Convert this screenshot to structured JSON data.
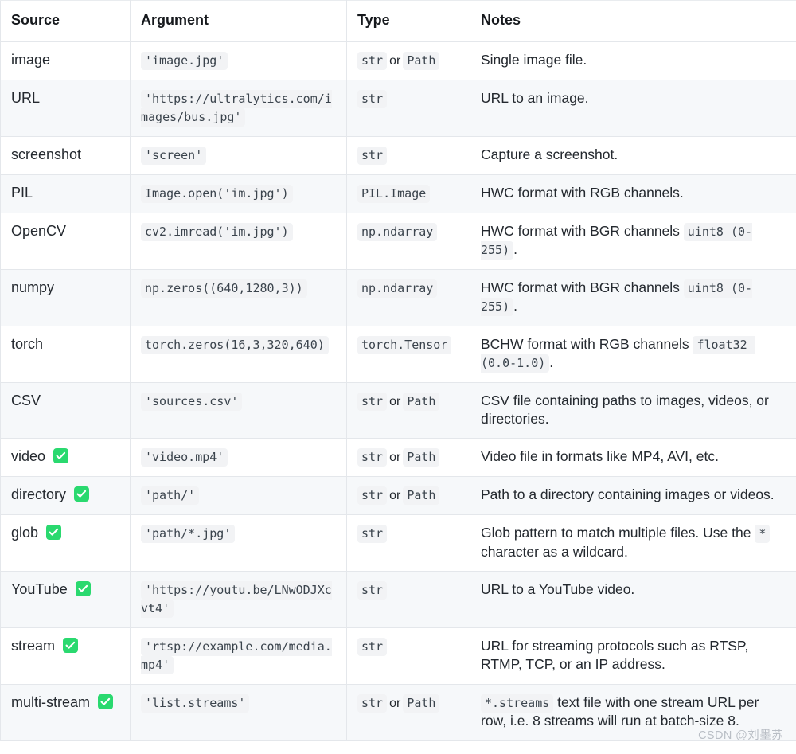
{
  "table": {
    "columns": [
      "Source",
      "Argument",
      "Type",
      "Notes"
    ],
    "rows": [
      {
        "source": "image",
        "verified": false,
        "argument": "'image.jpg'",
        "type_codes": [
          "str",
          "Path"
        ],
        "type_separator": "or",
        "notes_parts": [
          {
            "kind": "text",
            "text": "Single image file."
          }
        ]
      },
      {
        "source": "URL",
        "verified": false,
        "argument": "'https://ultralytics.com/images/bus.jpg'",
        "type_codes": [
          "str"
        ],
        "type_separator": "",
        "notes_parts": [
          {
            "kind": "text",
            "text": "URL to an image."
          }
        ]
      },
      {
        "source": "screenshot",
        "verified": false,
        "argument": "'screen'",
        "type_codes": [
          "str"
        ],
        "type_separator": "",
        "notes_parts": [
          {
            "kind": "text",
            "text": "Capture a screenshot."
          }
        ]
      },
      {
        "source": "PIL",
        "verified": false,
        "argument": "Image.open('im.jpg')",
        "type_codes": [
          "PIL.Image"
        ],
        "type_separator": "",
        "notes_parts": [
          {
            "kind": "text",
            "text": "HWC format with RGB channels."
          }
        ]
      },
      {
        "source": "OpenCV",
        "verified": false,
        "argument": "cv2.imread('im.jpg')",
        "type_codes": [
          "np.ndarray"
        ],
        "type_separator": "",
        "notes_parts": [
          {
            "kind": "text",
            "text": "HWC format with BGR channels "
          },
          {
            "kind": "code",
            "text": "uint8 (0-255)"
          },
          {
            "kind": "text",
            "text": "."
          }
        ]
      },
      {
        "source": "numpy",
        "verified": false,
        "argument": "np.zeros((640,1280,3))",
        "type_codes": [
          "np.ndarray"
        ],
        "type_separator": "",
        "notes_parts": [
          {
            "kind": "text",
            "text": "HWC format with BGR channels "
          },
          {
            "kind": "code",
            "text": "uint8 (0-255)"
          },
          {
            "kind": "text",
            "text": "."
          }
        ]
      },
      {
        "source": "torch",
        "verified": false,
        "argument": "torch.zeros(16,3,320,640)",
        "type_codes": [
          "torch.Tensor"
        ],
        "type_separator": "",
        "notes_parts": [
          {
            "kind": "text",
            "text": "BCHW format with RGB channels "
          },
          {
            "kind": "code",
            "text": "float32 (0.0-1.0)"
          },
          {
            "kind": "text",
            "text": "."
          }
        ]
      },
      {
        "source": "CSV",
        "verified": false,
        "argument": "'sources.csv'",
        "type_codes": [
          "str",
          "Path"
        ],
        "type_separator": "or",
        "notes_parts": [
          {
            "kind": "text",
            "text": "CSV file containing paths to images, videos, or directories."
          }
        ]
      },
      {
        "source": "video",
        "verified": true,
        "argument": "'video.mp4'",
        "type_codes": [
          "str",
          "Path"
        ],
        "type_separator": "or",
        "notes_parts": [
          {
            "kind": "text",
            "text": "Video file in formats like MP4, AVI, etc."
          }
        ]
      },
      {
        "source": "directory",
        "verified": true,
        "argument": "'path/'",
        "type_codes": [
          "str",
          "Path"
        ],
        "type_separator": "or",
        "notes_parts": [
          {
            "kind": "text",
            "text": "Path to a directory containing images or videos."
          }
        ]
      },
      {
        "source": "glob",
        "verified": true,
        "argument": "'path/*.jpg'",
        "type_codes": [
          "str"
        ],
        "type_separator": "",
        "notes_parts": [
          {
            "kind": "text",
            "text": "Glob pattern to match multiple files. Use the "
          },
          {
            "kind": "code",
            "text": "*"
          },
          {
            "kind": "text",
            "text": " character as a wildcard."
          }
        ]
      },
      {
        "source": "YouTube",
        "verified": true,
        "argument": "'https://youtu.be/LNwODJXcvt4'",
        "type_codes": [
          "str"
        ],
        "type_separator": "",
        "notes_parts": [
          {
            "kind": "text",
            "text": "URL to a YouTube video."
          }
        ]
      },
      {
        "source": "stream",
        "verified": true,
        "argument": "'rtsp://example.com/media.mp4'",
        "type_codes": [
          "str"
        ],
        "type_separator": "",
        "notes_parts": [
          {
            "kind": "text",
            "text": "URL for streaming protocols such as RTSP, RTMP, TCP, or an IP address."
          }
        ]
      },
      {
        "source": "multi-stream",
        "verified": true,
        "argument": "'list.streams'",
        "type_codes": [
          "str",
          "Path"
        ],
        "type_separator": "or",
        "notes_parts": [
          {
            "kind": "code",
            "text": "*.streams"
          },
          {
            "kind": "text",
            "text": " text file with one stream URL per row, i.e. 8 streams will run at batch-size 8."
          }
        ]
      }
    ]
  },
  "watermark": {
    "text": "CSDN @刘墨苏"
  },
  "colors": {
    "check_badge_green": "#2ad96f",
    "stripe_background": "#f6f8fa",
    "border": "#e4e7eb",
    "code_background": "#f2f3f5",
    "text": "#24292f",
    "watermark_text": "#b9bec5"
  },
  "icons": {
    "check": "check-mark-icon"
  }
}
